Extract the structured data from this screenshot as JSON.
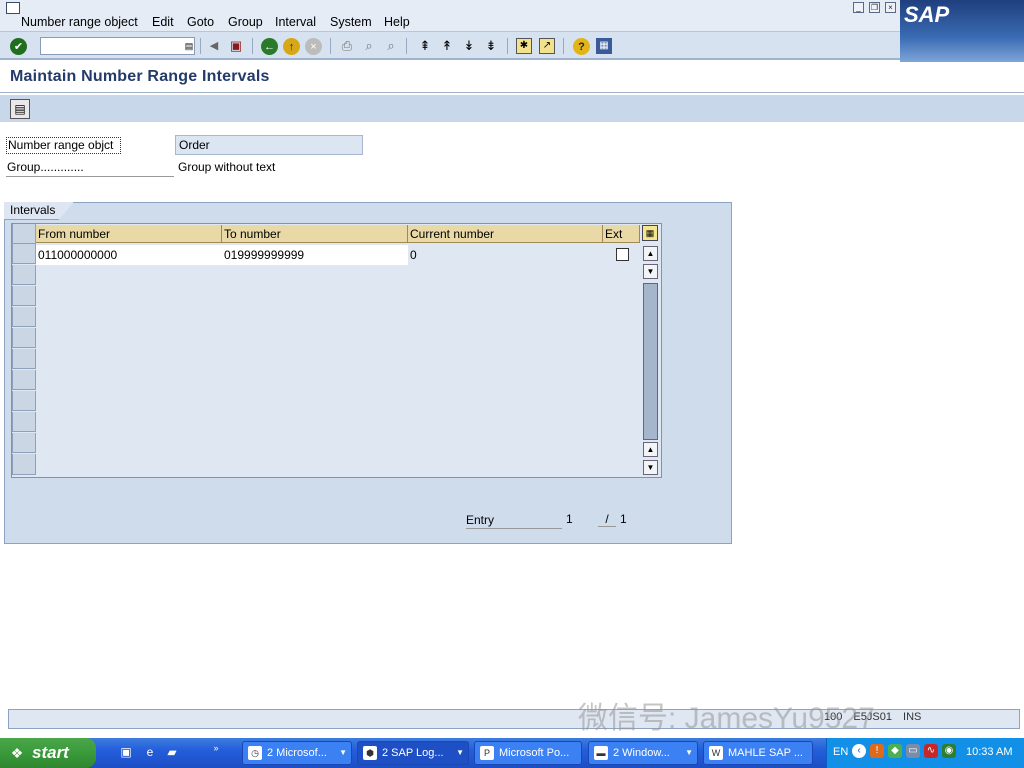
{
  "window": {
    "minimize_glyph": "_",
    "restore_glyph": "❐",
    "close_glyph": "×",
    "logo_text": "SAP"
  },
  "menu": {
    "items": [
      "Number range object",
      "Edit",
      "Goto",
      "Group",
      "Interval",
      "System",
      "Help"
    ]
  },
  "toolbar": {
    "command_field_value": "",
    "icons": [
      "enter-icon",
      "command-dropdown-icon",
      "back-arrow-icon",
      "save-icon",
      "back-icon",
      "exit-icon",
      "cancel-icon",
      "print-icon",
      "find-icon",
      "find-next-icon",
      "first-page-icon",
      "previous-page-icon",
      "next-page-icon",
      "last-page-icon",
      "create-session-icon",
      "shortcut-icon",
      "help-icon",
      "layout-menu-icon"
    ]
  },
  "page": {
    "title": "Maintain Number Range Intervals"
  },
  "fields": {
    "number_range_object_label": "Number range objct",
    "number_range_object_value": "Order",
    "group_label": "Group.............",
    "group_value": "Group without text"
  },
  "intervals": {
    "group_title": "Intervals",
    "columns": [
      "From number",
      "To number",
      "Current number",
      "Ext"
    ],
    "rows": [
      {
        "from": "011000000000",
        "to": "019999999999",
        "current": "0",
        "ext": false
      }
    ],
    "entry_label": "Entry",
    "entry_current": "1",
    "entry_separator": "/",
    "entry_total": "1"
  },
  "status": {
    "client": "100",
    "server": "E5JS01",
    "mode": "INS"
  },
  "taskbar": {
    "start_label": "start",
    "tasks": [
      {
        "label": "2 Microsof...",
        "icon": "outlook-icon"
      },
      {
        "label": "2 SAP Log...",
        "icon": "sap-logon-icon"
      },
      {
        "label": "Microsoft Po...",
        "icon": "powerpoint-icon"
      },
      {
        "label": "2 Window...",
        "icon": "folder-icon"
      },
      {
        "label": "MAHLE SAP ...",
        "icon": "word-icon"
      }
    ],
    "language": "EN",
    "clock": "10:33 AM"
  },
  "watermark": "微信号: JamesYu9527"
}
